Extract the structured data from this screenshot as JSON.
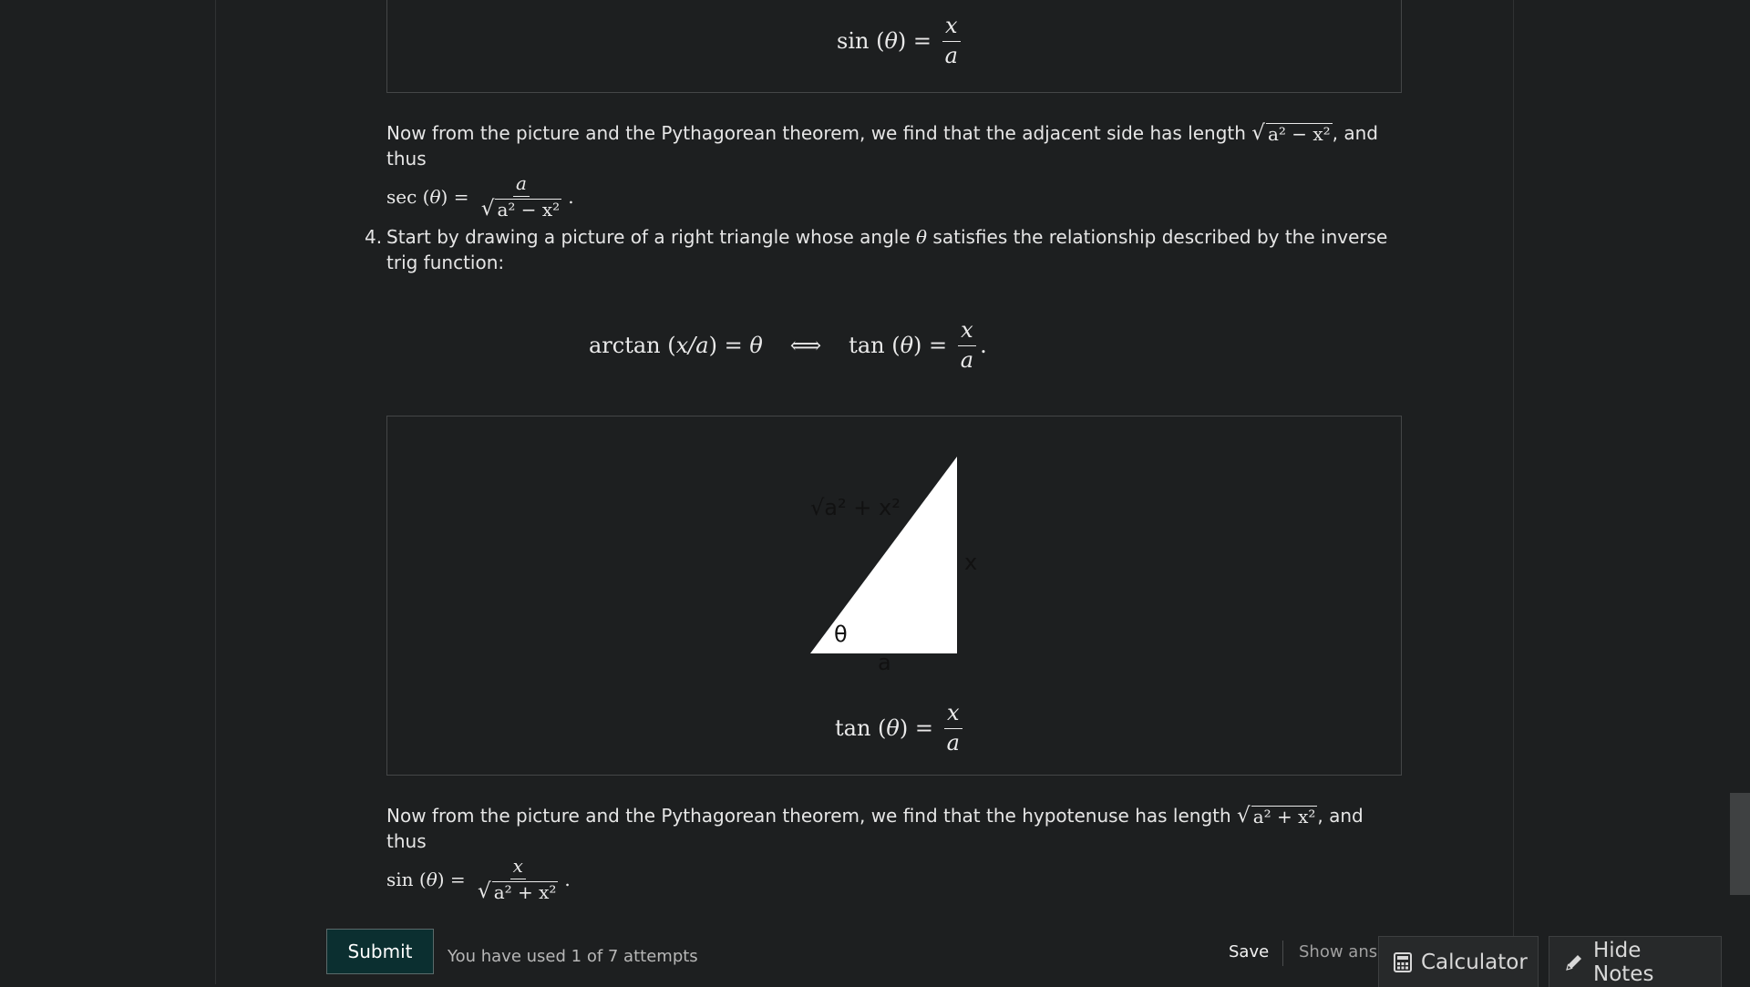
{
  "section3": {
    "box_eq": {
      "lhs": "sin",
      "theta": "θ",
      "num": "x",
      "den": "a"
    },
    "para_text": "Now from the picture and the Pythagorean theorem, we find that the adjacent side has length",
    "para_sqrt": "a² − x²",
    "para_tail": ", and thus",
    "result": {
      "lhs": "sec",
      "theta": "θ",
      "num": "a",
      "den_sqrt": "a² − x²"
    }
  },
  "item4": {
    "number": "4.",
    "text_a": "Start by drawing a picture of a right triangle whose angle",
    "theta": "θ",
    "text_b": "satisfies the relationship described by the inverse trig function:",
    "equation": {
      "left_fn": "arctan",
      "left_arg": "x/a",
      "theta": "θ",
      "arrow": "⟺",
      "right_fn": "tan",
      "num": "x",
      "den": "a"
    }
  },
  "triangle": {
    "hypotenuse_label": "√a² + x²",
    "opposite_label": "x",
    "adjacent_label": "a",
    "angle_label": "θ",
    "caption": {
      "lhs": "tan",
      "theta": "θ",
      "num": "x",
      "den": "a"
    }
  },
  "conclusion": {
    "text": "Now from the picture and the Pythagorean theorem, we find that the hypotenuse has length",
    "sqrt": "a² + x²",
    "tail": ", and thus",
    "result": {
      "lhs": "sin",
      "theta": "θ",
      "num": "x",
      "den_sqrt": "a² + x²"
    }
  },
  "actions": {
    "submit_label": "Submit",
    "attempts_text": "You have used 1 of 7 attempts",
    "save_label": "Save",
    "show_answer_label": "Show answer"
  },
  "tools": {
    "calculator_label": "Calculator",
    "calculator_icon": "calculator-icon",
    "notes_label": "Hide Notes",
    "notes_icon": "pencil-icon"
  }
}
